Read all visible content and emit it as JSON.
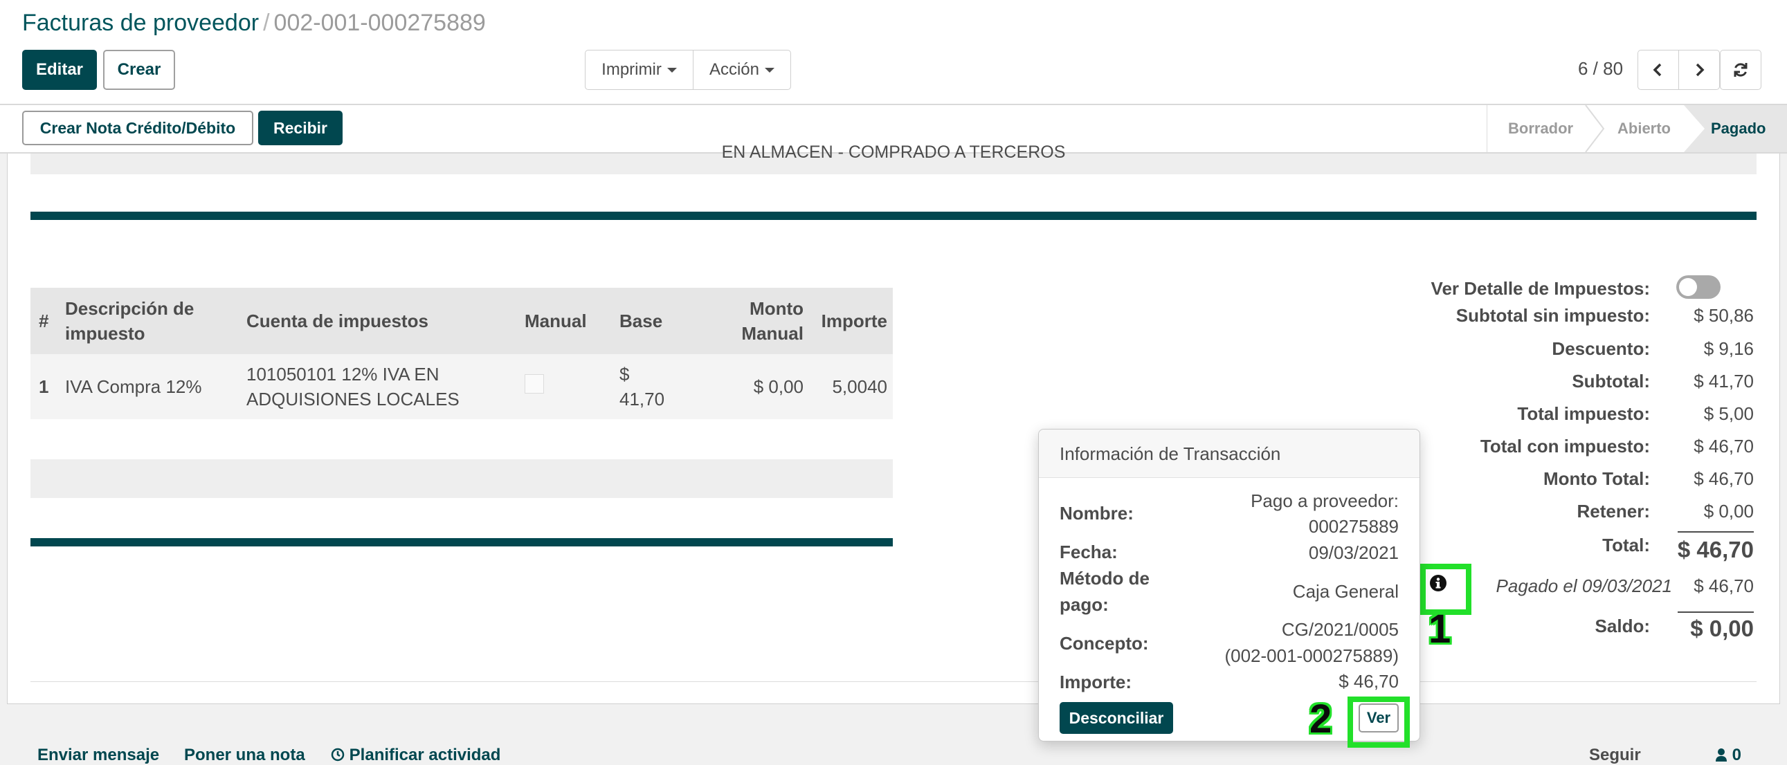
{
  "breadcrumb": {
    "parent": "Facturas de proveedor",
    "separator": "/",
    "current": "002-001-000275889"
  },
  "toolbar": {
    "edit_label": "Editar",
    "create_label": "Crear",
    "print_label": "Imprimir",
    "action_label": "Acción"
  },
  "pager": {
    "value": "6 / 80"
  },
  "actions": {
    "credit_note_label": "Crear Nota Crédito/Débito",
    "receive_label": "Recibir"
  },
  "status": {
    "stages": [
      "Borrador",
      "Abierto",
      "Pagado"
    ],
    "active": "Pagado"
  },
  "sheet": {
    "clipped_text": "EN ALMACEN - COMPRADO A TERCEROS"
  },
  "tax_table": {
    "headers": {
      "num": "#",
      "desc": "Descripción de impuesto",
      "account": "Cuenta de impuestos",
      "manual": "Manual",
      "base": "Base",
      "manual_amount": "Monto Manual",
      "amount": "Importe"
    },
    "rows": [
      {
        "num": "1",
        "desc": "IVA Compra 12%",
        "account": "101050101 12% IVA EN ADQUISIONES LOCALES",
        "base": "$ 41,70",
        "manual_amount": "$ 0,00",
        "amount": "5,0040"
      }
    ]
  },
  "totals": {
    "tax_detail_label": "Ver Detalle de Impuestos:",
    "subtotal_no_tax_label": "Subtotal sin impuesto:",
    "subtotal_no_tax": "$ 50,86",
    "discount_label": "Descuento:",
    "discount": "$ 9,16",
    "subtotal_label": "Subtotal:",
    "subtotal": "$ 41,70",
    "total_tax_label": "Total impuesto:",
    "total_tax": "$ 5,00",
    "total_with_tax_label": "Total con impuesto:",
    "total_with_tax": "$ 46,70",
    "amount_total_label": "Monto Total:",
    "amount_total": "$ 46,70",
    "withhold_label": "Retener:",
    "withhold": "$ 0,00",
    "total_label": "Total:",
    "total": "$ 46,70",
    "paid_on": "Pagado el 09/03/2021",
    "paid_amount": "$ 46,70",
    "balance_label": "Saldo:",
    "balance": "$ 0,00"
  },
  "popover": {
    "title": "Información de Transacción",
    "name_label": "Nombre:",
    "name_line1": "Pago a proveedor:",
    "name_line2": "000275889",
    "date_label": "Fecha:",
    "date": "09/03/2021",
    "method_label_1": "Método de",
    "method_label_2": "pago:",
    "method": "Caja General",
    "concept_label": "Concepto:",
    "concept_line1": "CG/2021/0005",
    "concept_line2": "(002-001-000275889)",
    "amount_label": "Importe:",
    "amount": "$ 46,70",
    "unreconcile_label": "Desconciliar",
    "view_label": "Ver"
  },
  "annotations": {
    "one": "1",
    "two": "2"
  },
  "chatter": {
    "send_message": "Enviar mensaje",
    "log_note": "Poner una nota",
    "schedule": "Planificar actividad",
    "follow": "Seguir",
    "followers": "0"
  },
  "colors": {
    "primary": "#01474f",
    "highlight": "#22e02a"
  }
}
